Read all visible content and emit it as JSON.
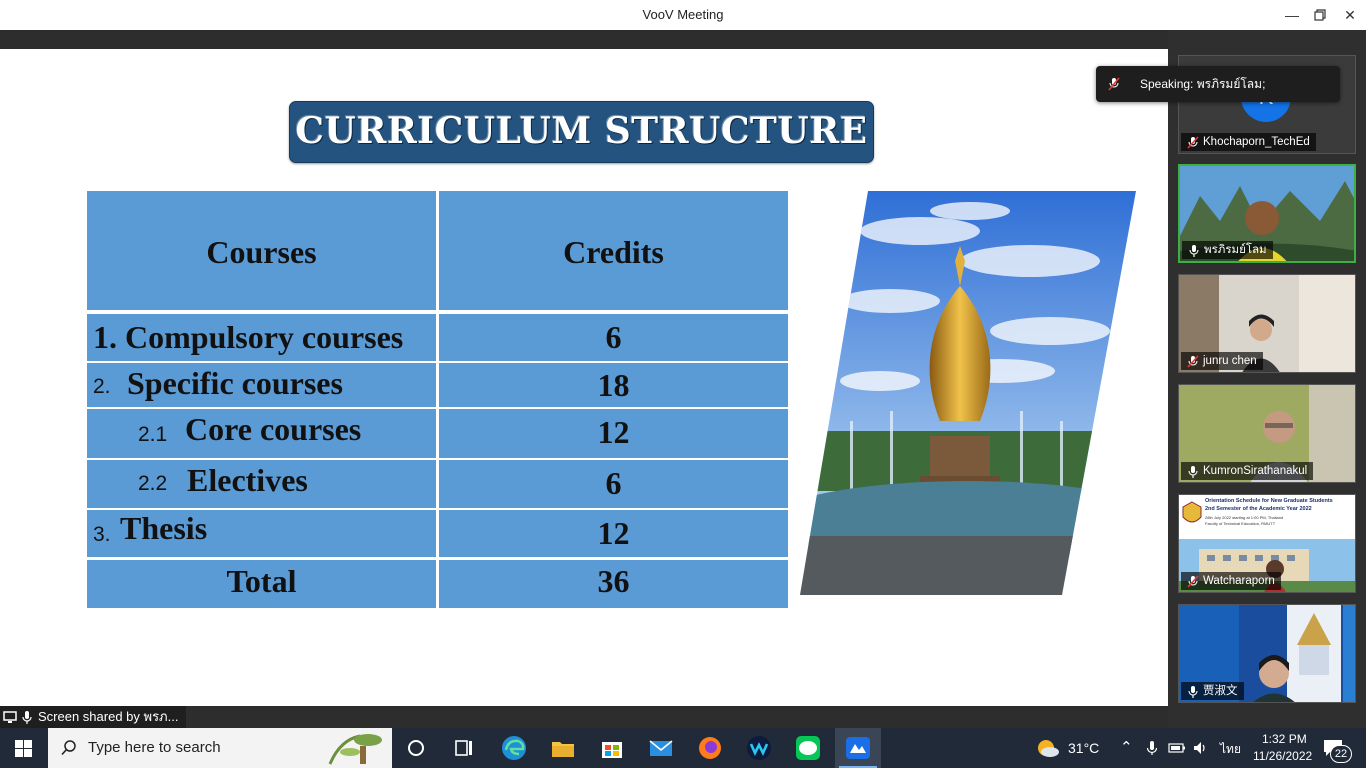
{
  "window": {
    "title": "VooV Meeting"
  },
  "slide": {
    "title": "CURRICULUM STRUCTURE",
    "table": {
      "headers": [
        "Courses",
        "Credits"
      ],
      "rows": [
        {
          "num": "",
          "course": "1. Compulsory courses",
          "credits": "6"
        },
        {
          "num": "2.",
          "course": "Specific courses",
          "credits": "18"
        },
        {
          "num": "2.1",
          "course": "Core courses",
          "credits": "12"
        },
        {
          "num": "2.2",
          "course": "Electives",
          "credits": "6"
        },
        {
          "num": "3.",
          "course": "Thesis",
          "credits": "12"
        }
      ],
      "total": {
        "label": "Total",
        "credits": "36"
      }
    }
  },
  "share_label": "Screen shared by พรภ...",
  "speaking": "Speaking: พรภิรมย์โลม;",
  "participants": [
    {
      "name": "Khochaporn_TechEd",
      "muted": true,
      "avatar_letter": "K"
    },
    {
      "name": "พรภิรมย์โลม",
      "muted": false
    },
    {
      "name": "junru  chen",
      "muted": true
    },
    {
      "name": "KumronSirathanakul",
      "muted": false
    },
    {
      "name": "Watcharaporn",
      "muted": true
    },
    {
      "name": "贾淑文",
      "muted": false
    }
  ],
  "shared_doc_tile": {
    "heading": "Orientation Schedule for New Graduate Students",
    "subheading": "2nd Semester of the Academic Year 2022",
    "line3": "28th July 2022 starting at 1:00 PM, Thailand",
    "line4": "Faculty of Technical Education, RMUTT"
  },
  "taskbar": {
    "search_placeholder": "Type here to search",
    "weather": "31°C",
    "language": "ไทย",
    "time": "1:32 PM",
    "date": "11/26/2022",
    "notifications": "22"
  },
  "colors": {
    "table_blue": "#5b9bd5",
    "title_navy": "#23537e",
    "active_border": "#3cb043"
  }
}
